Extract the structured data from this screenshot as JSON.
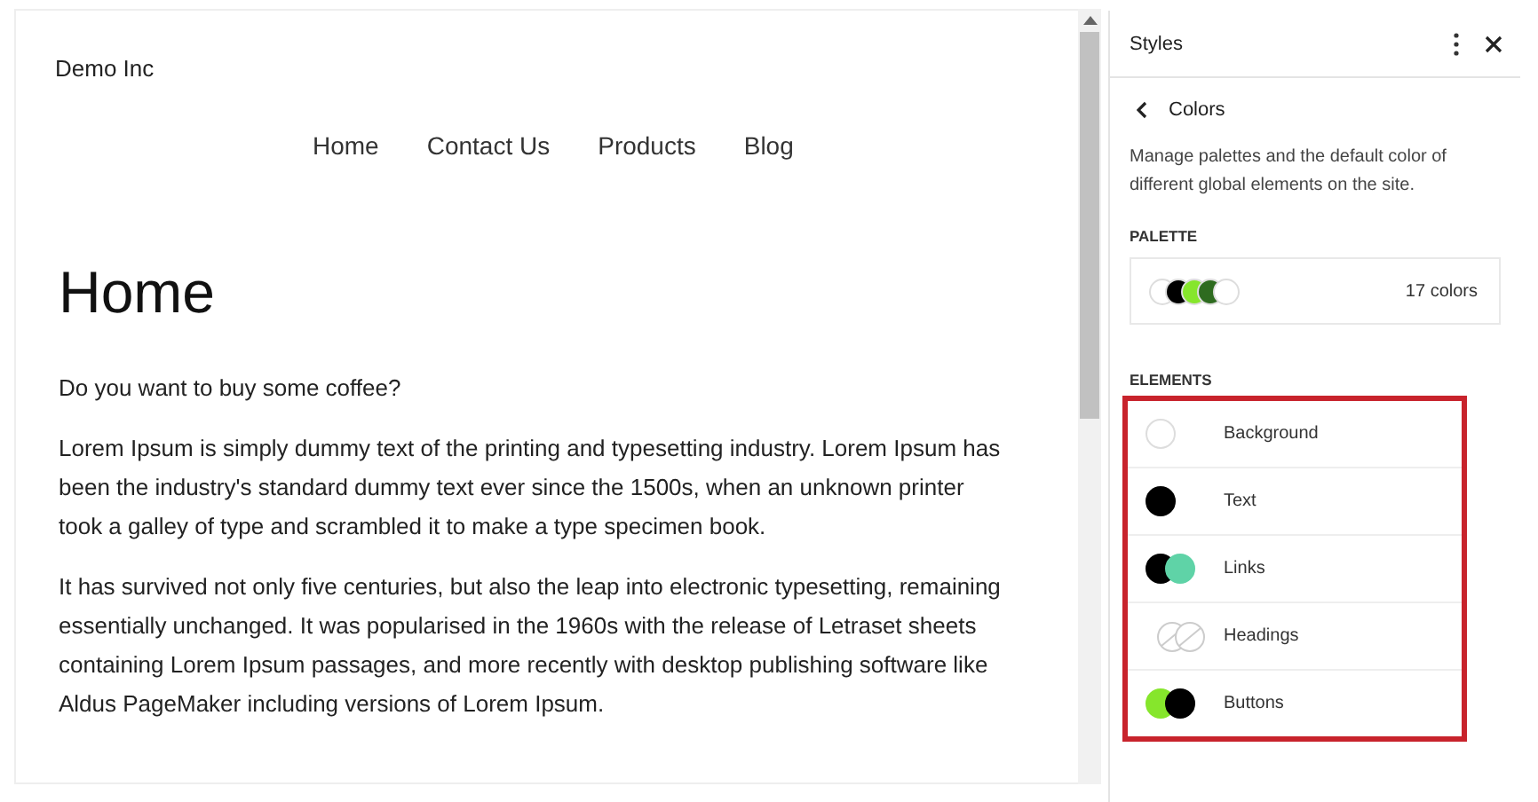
{
  "site": {
    "name": "Demo Inc",
    "nav": [
      "Home",
      "Contact Us",
      "Products",
      "Blog"
    ],
    "title": "Home",
    "paragraphs": [
      "Do you want to buy some coffee?",
      "Lorem Ipsum is simply dummy text of the printing and typesetting industry. Lorem Ipsum has been the industry's standard dummy text ever since the 1500s, when an unknown printer took a galley of type and scrambled it to make a type specimen book.",
      "It has survived not only five centuries, but also the leap into electronic typesetting, remaining essentially unchanged. It was popularised in the 1960s with the release of Letraset sheets containing Lorem Ipsum passages, and more recently with desktop publishing software like Aldus PageMaker including versions of Lorem Ipsum."
    ]
  },
  "sidebar": {
    "title": "Styles",
    "back_title": "Colors",
    "description": "Manage palettes and the default color of different global elements on the site.",
    "palette": {
      "heading": "PALETTE",
      "swatches": [
        {
          "color": "#ffffff"
        },
        {
          "color": "#000000"
        },
        {
          "color": "#86e62c"
        },
        {
          "color": "#2e6b1f"
        },
        {
          "color": "#ffffff"
        }
      ],
      "count": "17 colors"
    },
    "elements": {
      "heading": "ELEMENTS",
      "highlighted": true,
      "items": [
        {
          "label": "Background",
          "kind": "swatch",
          "colors": [
            {
              "color": "#ffffff"
            }
          ]
        },
        {
          "label": "Text",
          "kind": "swatch",
          "colors": [
            {
              "color": "#000000"
            }
          ]
        },
        {
          "label": "Links",
          "kind": "swatch",
          "colors": [
            {
              "color": "#000000"
            },
            {
              "color": "#5fd3a7"
            }
          ]
        },
        {
          "label": "Headings",
          "kind": "unset"
        },
        {
          "label": "Buttons",
          "kind": "swatch",
          "colors": [
            {
              "color": "#86e62c"
            },
            {
              "color": "#000000"
            }
          ]
        }
      ]
    }
  }
}
